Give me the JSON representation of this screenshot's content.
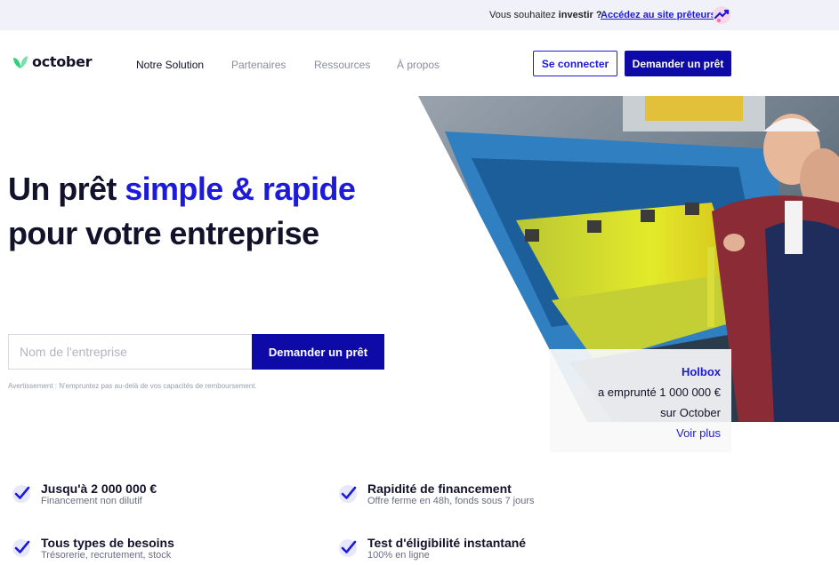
{
  "topbar": {
    "prefix": "Vous souhaitez ",
    "bold": "investir ?",
    "link": "Accédez au site prêteurs"
  },
  "nav": {
    "logo": "october",
    "items": [
      "Notre Solution",
      "Partenaires",
      "Ressources",
      "À propos"
    ],
    "connect": "Se connecter",
    "loan": "Demander un prêt"
  },
  "hero": {
    "title_start": "Un prêt ",
    "title_accent": "simple & rapide",
    "title_end": "pour votre entreprise",
    "search_placeholder": "Nom de l'entreprise",
    "cta": "Demander un prêt",
    "warning": "Avertissement : N'empruntez pas au-delà de vos capacités de remboursement."
  },
  "testimonial": {
    "company": "Holbox",
    "line1": "a emprunté 1 000 000 €",
    "line2": "sur October",
    "more": "Voir plus"
  },
  "features": [
    {
      "title": "Jusqu'à 2 000 000 €",
      "subtitle": "Financement non dilutif"
    },
    {
      "title": "Rapidité de financement",
      "subtitle": "Offre ferme en 48h, fonds sous 7 jours"
    },
    {
      "title": "Tous types de besoins",
      "subtitle": "Trésorerie, recrutement, stock"
    },
    {
      "title": "Test d'éligibilité instantané",
      "subtitle": "100% en ligne"
    }
  ],
  "colors": {
    "brand_blue": "#1d1bd9",
    "button_dark": "#0d0aa8",
    "logo_green": "#2fd07a",
    "topbar_bg": "#f1f2f9"
  },
  "icons": [
    "investor-icon",
    "october-logo-icon",
    "check-icon"
  ]
}
